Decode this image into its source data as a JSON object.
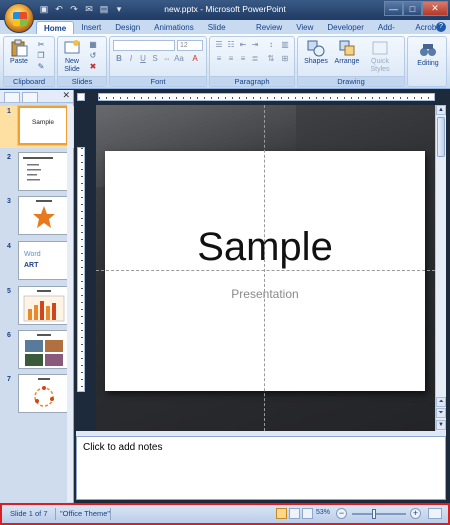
{
  "window": {
    "title": "new.pptx - Microsoft PowerPoint",
    "controls": [
      "—",
      "□",
      "✕"
    ]
  },
  "quick_access": {
    "icons": [
      "save-icon",
      "undo-icon",
      "redo-icon",
      "email-icon",
      "print-icon",
      "customize-icon"
    ]
  },
  "ribbon": {
    "tabs": [
      "Home",
      "Insert",
      "Design",
      "Animations",
      "Slide Show",
      "Review",
      "View",
      "Developer",
      "Add-Ins",
      "Acrobat"
    ],
    "active_tab": "Home",
    "groups": {
      "clipboard": {
        "label": "Clipboard",
        "paste": "Paste"
      },
      "slides": {
        "label": "Slides",
        "new_slide_line1": "New",
        "new_slide_line2": "Slide"
      },
      "font": {
        "label": "Font",
        "size": "12"
      },
      "paragraph": {
        "label": "Paragraph"
      },
      "drawing": {
        "label": "Drawing",
        "shapes": "Shapes",
        "arrange": "Arrange",
        "quick_styles_line1": "Quick",
        "quick_styles_line2": "Styles"
      },
      "editing": {
        "label": "Editing"
      }
    }
  },
  "slides_pane": {
    "thumbnails": [
      {
        "number": "1",
        "title": "Sample",
        "selected": true
      },
      {
        "number": "2",
        "title": ""
      },
      {
        "number": "3",
        "title": ""
      },
      {
        "number": "4",
        "title": "Word",
        "subtitle": "ART"
      },
      {
        "number": "5",
        "title": ""
      },
      {
        "number": "6",
        "title": ""
      },
      {
        "number": "7",
        "title": ""
      }
    ]
  },
  "slide": {
    "title": "Sample",
    "subtitle": "Presentation"
  },
  "notes": {
    "placeholder": "Click to add notes"
  },
  "status": {
    "slide_info": "Slide 1 of 7",
    "theme": "\"Office Theme\"",
    "zoom": "53%"
  }
}
